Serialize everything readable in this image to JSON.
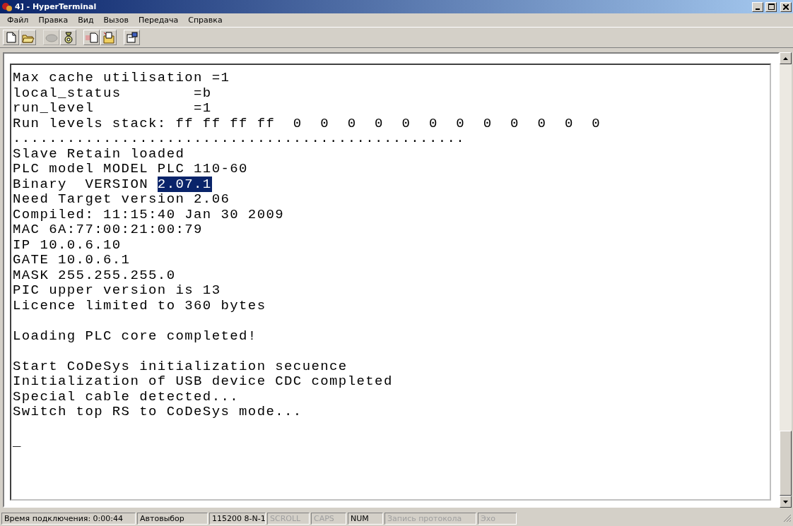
{
  "window": {
    "title": "4] - HyperTerminal"
  },
  "menu": [
    "Файл",
    "Правка",
    "Вид",
    "Вызов",
    "Передача",
    "Справка"
  ],
  "toolbar": [
    {
      "kind": "new",
      "disabled": false
    },
    {
      "kind": "open",
      "disabled": false
    },
    {
      "kind": "separator"
    },
    {
      "kind": "disconnect",
      "disabled": true
    },
    {
      "kind": "call",
      "disabled": false
    },
    {
      "kind": "separator"
    },
    {
      "kind": "send",
      "disabled": false
    },
    {
      "kind": "receive",
      "disabled": false
    },
    {
      "kind": "separator"
    },
    {
      "kind": "properties",
      "disabled": false
    }
  ],
  "terminal": {
    "lines": [
      {
        "kind": "text",
        "text": "Max cache utilisation =1"
      },
      {
        "kind": "text",
        "text": "local_status        =b"
      },
      {
        "kind": "text",
        "text": "run_level           =1"
      },
      {
        "kind": "text",
        "text": "Run levels stack: ff ff ff ff  0  0  0  0  0  0  0  0  0  0  0  0"
      },
      {
        "kind": "text",
        "text": ".................................................."
      },
      {
        "kind": "text",
        "text": "Slave Retain loaded"
      },
      {
        "kind": "text",
        "text": "PLC model MODEL PLC 110-60"
      },
      {
        "kind": "text",
        "text": "Binary  VERSION ",
        "selected_text": "2.07.1"
      },
      {
        "kind": "text",
        "text": "Need Target version 2.06"
      },
      {
        "kind": "text",
        "text": "Compiled: 11:15:40 Jan 30 2009"
      },
      {
        "kind": "text",
        "text": "MAC 6A:77:00:21:00:79"
      },
      {
        "kind": "text",
        "text": "IP 10.0.6.10"
      },
      {
        "kind": "text",
        "text": "GATE 10.0.6.1"
      },
      {
        "kind": "text",
        "text": "MASK 255.255.255.0"
      },
      {
        "kind": "text",
        "text": "PIC upper version is 13"
      },
      {
        "kind": "text",
        "text": "Licence limited to 360 bytes"
      },
      {
        "kind": "blank"
      },
      {
        "kind": "text",
        "text": "Loading PLC core completed!"
      },
      {
        "kind": "blank"
      },
      {
        "kind": "text",
        "text": "Start CoDeSys initialization secuence"
      },
      {
        "kind": "text",
        "text": "Initialization of USB device CDC completed"
      },
      {
        "kind": "text",
        "text": "Special cable detected..."
      },
      {
        "kind": "text",
        "text": "Switch top RS to CoDeSys mode..."
      },
      {
        "kind": "blank"
      },
      {
        "kind": "cursor",
        "text": "_"
      }
    ]
  },
  "status_bar": [
    {
      "text": "Время подключения: 0:00:44",
      "active": true
    },
    {
      "text": "Автовыбор",
      "active": true
    },
    {
      "text": "115200 8-N-1",
      "active": true
    },
    {
      "text": "SCROLL",
      "active": false
    },
    {
      "text": "CAPS",
      "active": false
    },
    {
      "text": "NUM",
      "active": true
    },
    {
      "text": "Запись протокола",
      "active": false
    },
    {
      "text": "Эхо",
      "active": false
    }
  ]
}
